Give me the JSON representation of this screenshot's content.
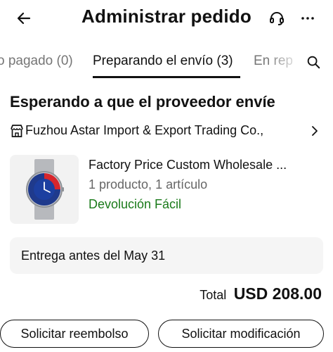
{
  "header": {
    "title": "Administrar pedido",
    "back_icon": "arrow-left-icon",
    "support_icon": "headset-icon",
    "more_icon": "more-horizontal-icon"
  },
  "tabs": {
    "items": [
      {
        "label": "o pagado (0)",
        "active": false
      },
      {
        "label": "Preparando el envío (3)",
        "active": true
      },
      {
        "label": "En rep",
        "active": false
      }
    ],
    "search_icon": "search-icon"
  },
  "order": {
    "status": "Esperando a que el proveedor envíe",
    "store_name": "Fuzhou Astar Import & Export Trading Co.,",
    "product": {
      "title": "Factory Price Custom Wholesale ...",
      "quantity": "1 producto, 1 artículo",
      "return_policy": "Devolución Fácil"
    },
    "delivery": "Entrega antes del May 31",
    "total_label": "Total",
    "total_amount": "USD 208.00"
  },
  "actions": {
    "refund": "Solicitar reembolso",
    "modify": "Solicitar modificación"
  },
  "colors": {
    "accent_green": "#1a7a1a",
    "text": "#111111",
    "muted": "#767676",
    "panel": "#f5f5f5"
  }
}
